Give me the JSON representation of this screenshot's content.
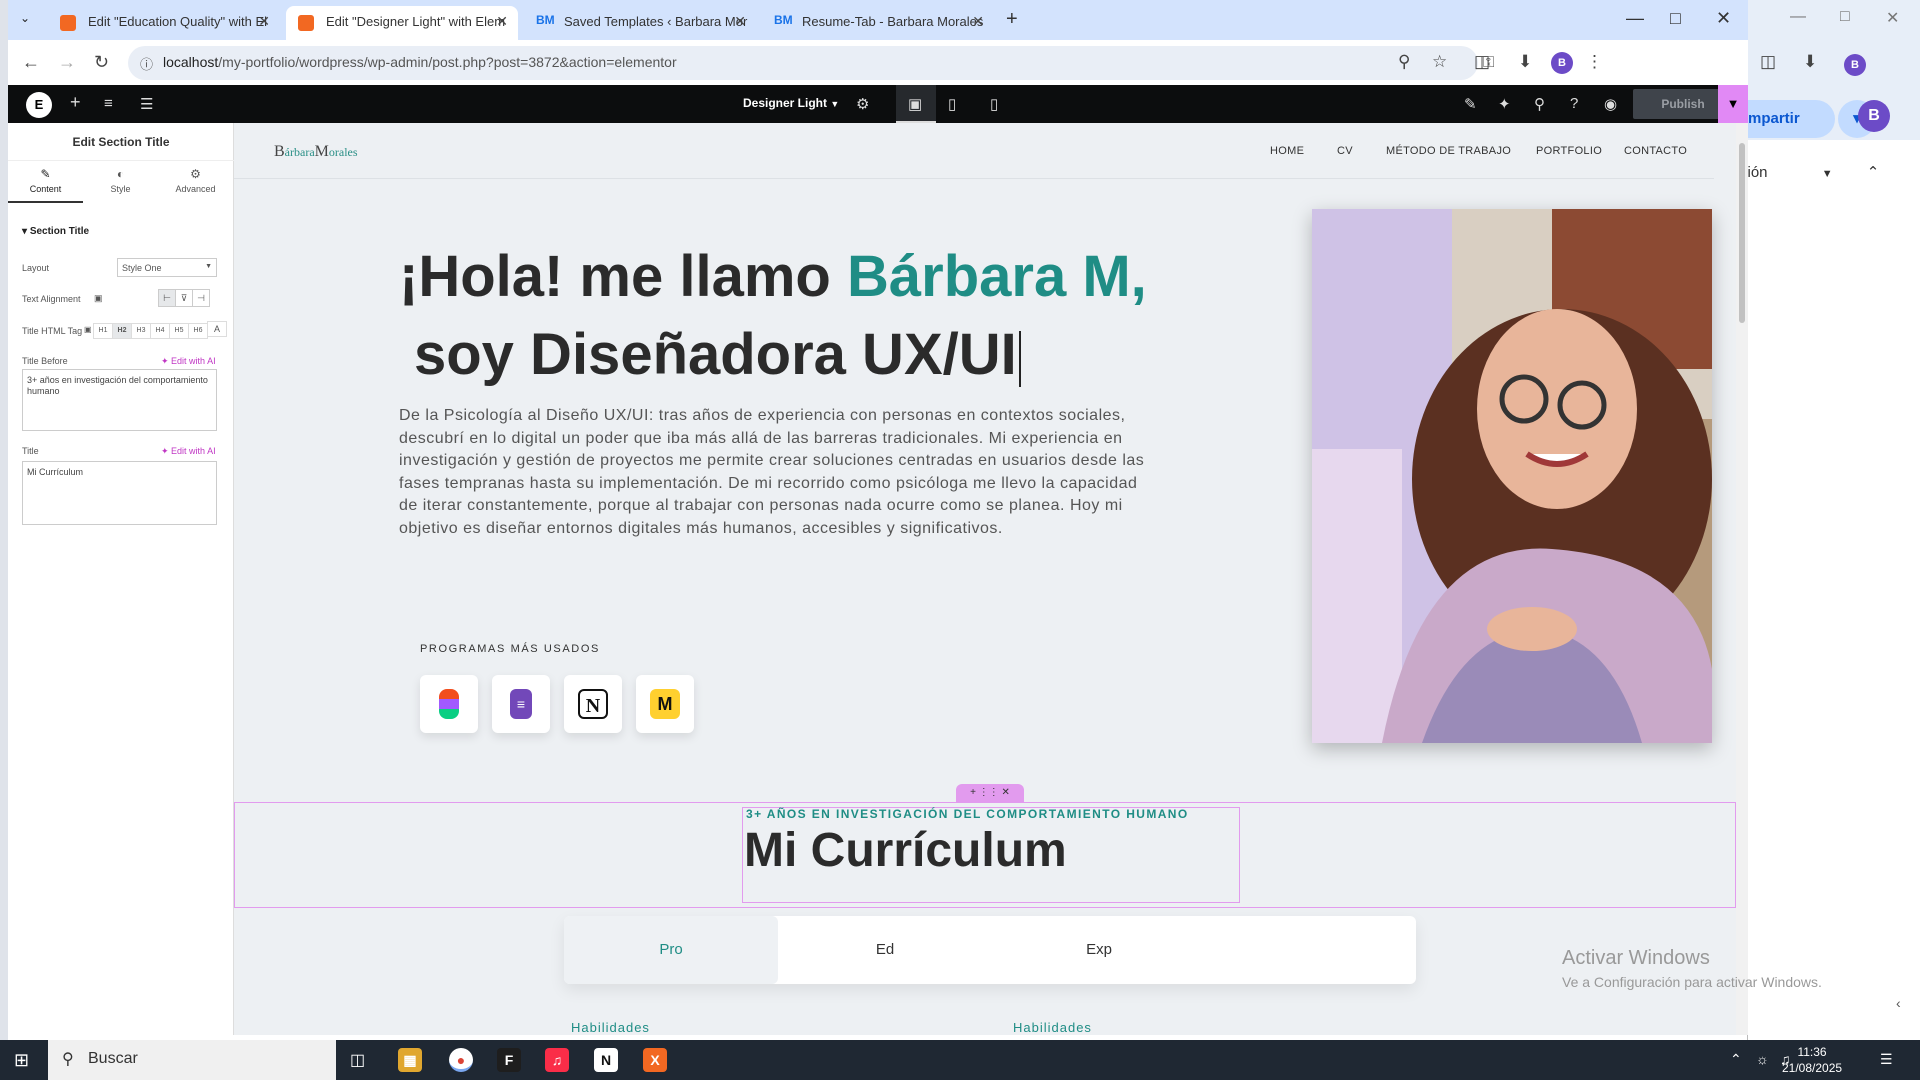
{
  "browser": {
    "tabs": [
      {
        "label": "Edit \"Education Quality\" with El",
        "icon": "elementor-icon"
      },
      {
        "label": "Edit \"Designer Light\" with Elem",
        "icon": "elementor-icon",
        "active": true
      },
      {
        "label": "Saved Templates ‹ Barbara Mor",
        "icon": "bm-icon"
      },
      {
        "label": "Resume-Tab - Barbara Morales",
        "icon": "bm-icon"
      }
    ],
    "url_host": "localhost",
    "url_path": "/my-portfolio/wordpress/wp-admin/post.php?post=3872&action=elementor",
    "profile_initial": "B"
  },
  "background_window": {
    "share_label": "mpartir",
    "section_label": "ción",
    "profile_initial": "B"
  },
  "elementor": {
    "template_name": "Designer Light",
    "publish_label": "Publish"
  },
  "panel": {
    "title": "Edit Section Title",
    "tabs": [
      "Content",
      "Style",
      "Advanced"
    ],
    "section": "Section Title",
    "layout_label": "Layout",
    "layout_value": "Style One",
    "alignment_label": "Text Alignment",
    "html_tag_label": "Title HTML Tag",
    "html_tags": [
      "H1",
      "H2",
      "H3",
      "H4",
      "H5",
      "H6",
      "A"
    ],
    "title_before_label": "Title Before",
    "edit_ai_label": "Edit with AI",
    "title_before_value": "3+ años en investigación del comportamiento humano",
    "title_label": "Title",
    "title_value": "Mi Currículum"
  },
  "site": {
    "logo": "BárbaraMorales",
    "logo_b": "B",
    "logo_arbara": "árbara",
    "logo_m": "M",
    "logo_orales": "orales",
    "menu": [
      "HOME",
      "CV",
      "MÉTODO DE TRABAJO",
      "PORTFOLIO",
      "CONTACTO"
    ],
    "hero_line1_a": "¡Hola! me llamo ",
    "hero_line1_b": "Bárbara M,",
    "hero_line2": "soy Diseñadora UX/UI",
    "paragraph": "De la Psicología al Diseño UX/UI: tras años de experiencia con personas en contextos sociales, descubrí en lo digital un poder que iba más allá de las barreras tradicionales. Mi experiencia en investigación y gestión de proyectos me permite crear soluciones centradas en usuarios desde las fases tempranas hasta su implementación. De mi recorrido como psicóloga me llevo la capacidad de iterar constantemente, porque al trabajar con personas nada ocurre como se planea. Hoy mi objetivo es diseñar entornos digitales más humanos, accesibles y significativos.",
    "programs_label": "PROGRAMAS MÁS USADOS",
    "programs": [
      "figma-icon",
      "google-forms-icon",
      "notion-icon",
      "miro-icon"
    ],
    "title_before": "3+ AÑOS EN INVESTIGACIÓN DEL COMPORTAMIENTO HUMANO",
    "section_title": "Mi Currículum",
    "cv_tabs": [
      "Pro",
      "Ed",
      "Exp"
    ],
    "skills_left": "Habilidades",
    "skills_right": "Habilidades",
    "accent_color": "#1f8d85"
  },
  "windows_watermark": {
    "line1": "Activar Windows",
    "line2": "Ve a Configuración para activar Windows."
  },
  "taskbar": {
    "search_placeholder": "Buscar",
    "time": "11:36",
    "date": "21/08/2025"
  }
}
